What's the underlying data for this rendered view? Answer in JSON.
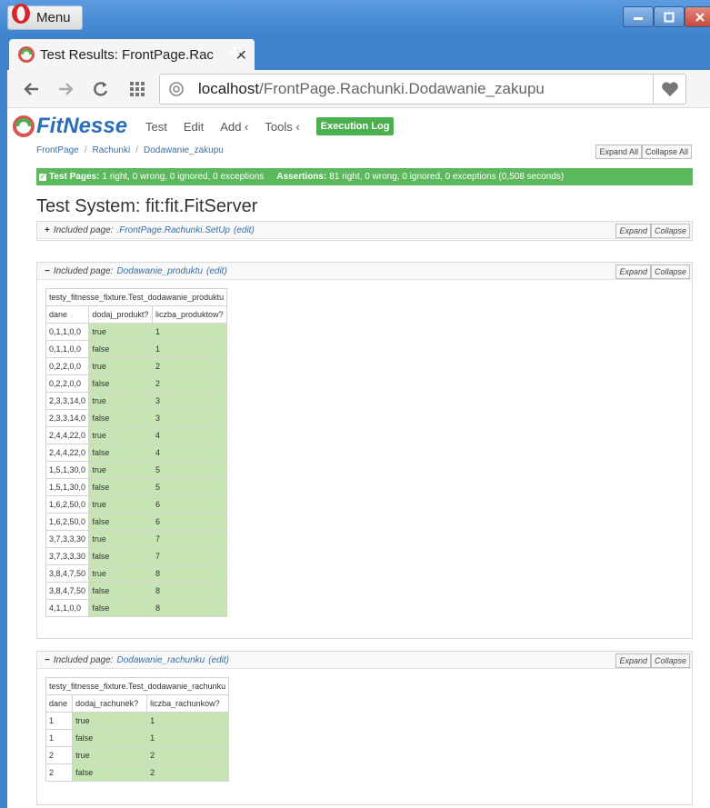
{
  "browser": {
    "menu_label": "Menu",
    "tab_title": "Test Results: FrontPage.Rac",
    "new_tab": "+",
    "url_host": "localhost",
    "url_path": "/FrontPage.Rachunki.Dodawanie_zakupu"
  },
  "fitnesse": {
    "logo": "FitNesse",
    "nav": {
      "test": "Test",
      "edit": "Edit",
      "add": "Add ‹",
      "tools": "Tools ‹",
      "exec_log": "Execution Log"
    },
    "breadcrumb": [
      "FrontPage",
      "Rachunki",
      "Dodawanie_zakupu"
    ],
    "expand_all": "Expand All",
    "collapse_all": "Collapse All",
    "summary": {
      "test_pages_label": "Test Pages:",
      "test_pages_value": "1 right, 0 wrong, 0 ignored, 0 exceptions",
      "assertions_label": "Assertions:",
      "assertions_value": "81 right, 0 wrong, 0 ignored, 0 exceptions (0,508 seconds)"
    },
    "test_system": "Test System: fit:fit.FitServer",
    "expand": "Expand",
    "collapse": "Collapse",
    "included_label": "Included page:",
    "edit_link": "(edit)",
    "setup": {
      "toggle": "+",
      "page": ".FrontPage.Rachunki.SetUp"
    },
    "section1": {
      "toggle": "−",
      "page": "Dodawanie_produktu",
      "fixture": "testy_fitnesse_fixture.Test_dodawanie_produktu",
      "headers": [
        "dane",
        "dodaj_produkt?",
        "liczba_produktow?"
      ],
      "rows": [
        [
          "0,1,1,0,0",
          "true",
          "1"
        ],
        [
          "0,1,1,0,0",
          "false",
          "1"
        ],
        [
          "0,2,2,0,0",
          "true",
          "2"
        ],
        [
          "0,2,2,0,0",
          "false",
          "2"
        ],
        [
          "2,3,3,14,0",
          "true",
          "3"
        ],
        [
          "2,3,3,14,0",
          "false",
          "3"
        ],
        [
          "2,4,4,22,0",
          "true",
          "4"
        ],
        [
          "2,4,4,22,0",
          "false",
          "4"
        ],
        [
          "1,5,1,30,0",
          "true",
          "5"
        ],
        [
          "1,5,1,30,0",
          "false",
          "5"
        ],
        [
          "1,6,2,50,0",
          "true",
          "6"
        ],
        [
          "1,6,2,50,0",
          "false",
          "6"
        ],
        [
          "3,7,3,3,30",
          "true",
          "7"
        ],
        [
          "3,7,3,3,30",
          "false",
          "7"
        ],
        [
          "3,8,4,7,50",
          "true",
          "8"
        ],
        [
          "3,8,4,7,50",
          "false",
          "8"
        ],
        [
          "4,1,1,0,0",
          "false",
          "8"
        ]
      ]
    },
    "section2": {
      "toggle": "−",
      "page": "Dodawanie_rachunku",
      "fixture": "testy_fitnesse_fixture.Test_dodawanie_rachunku",
      "headers": [
        "dane",
        "dodaj_rachunek?",
        "liczba_rachunkow?"
      ],
      "rows": [
        [
          "1",
          "true",
          "1"
        ],
        [
          "1",
          "false",
          "1"
        ],
        [
          "2",
          "true",
          "2"
        ],
        [
          "2",
          "false",
          "2"
        ]
      ]
    }
  }
}
